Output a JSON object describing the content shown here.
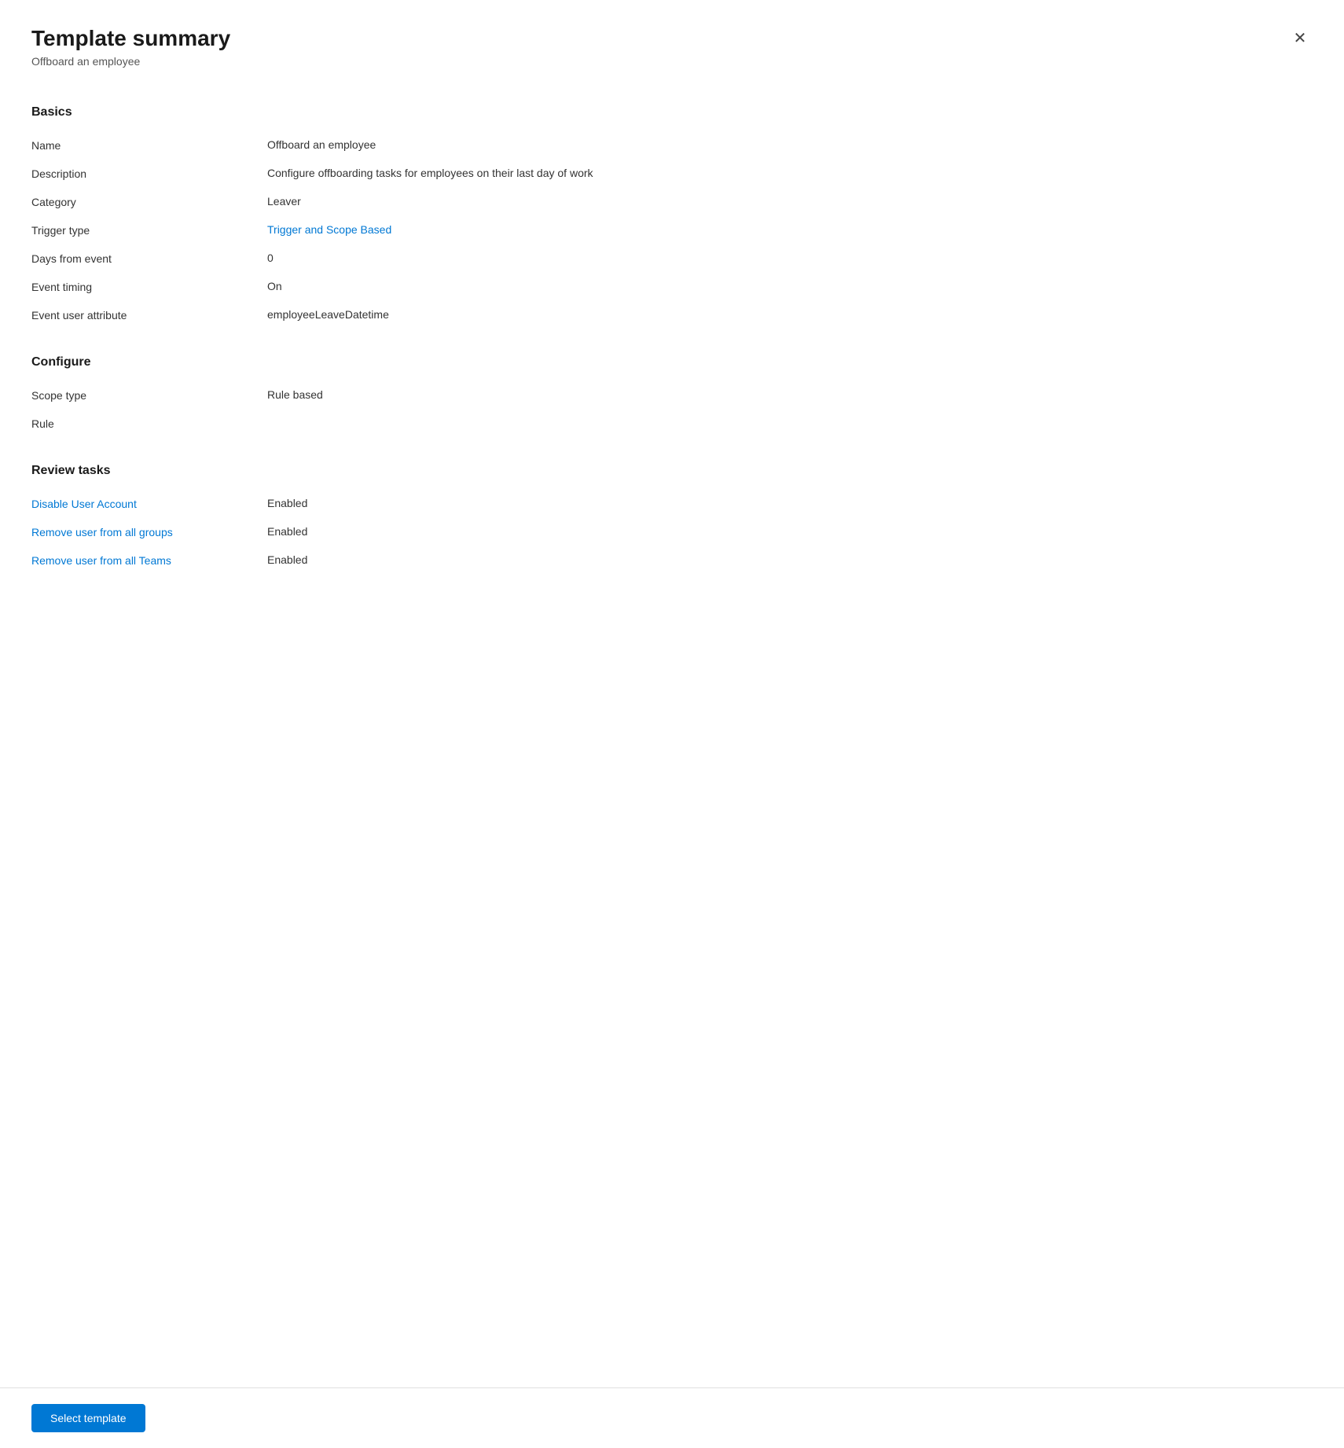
{
  "panel": {
    "title": "Template summary",
    "subtitle": "Offboard an employee",
    "close_label": "×"
  },
  "basics": {
    "section_title": "Basics",
    "fields": [
      {
        "label": "Name",
        "value": "Offboard an employee",
        "type": "text"
      },
      {
        "label": "Description",
        "value": "Configure offboarding tasks for employees on their last day of work",
        "type": "text"
      },
      {
        "label": "Category",
        "value": "Leaver",
        "type": "text"
      },
      {
        "label": "Trigger type",
        "value": "Trigger and Scope Based",
        "type": "link"
      },
      {
        "label": "Days from event",
        "value": "0",
        "type": "text"
      },
      {
        "label": "Event timing",
        "value": "On",
        "type": "text"
      },
      {
        "label": "Event user attribute",
        "value": "employeeLeaveDatetime",
        "type": "text"
      }
    ]
  },
  "configure": {
    "section_title": "Configure",
    "fields": [
      {
        "label": "Scope type",
        "value": "Rule based",
        "type": "text"
      },
      {
        "label": "Rule",
        "value": "",
        "type": "text"
      }
    ]
  },
  "review_tasks": {
    "section_title": "Review tasks",
    "fields": [
      {
        "label": "Disable User Account",
        "value": "Enabled",
        "type": "link"
      },
      {
        "label": "Remove user from all groups",
        "value": "Enabled",
        "type": "link"
      },
      {
        "label": "Remove user from all Teams",
        "value": "Enabled",
        "type": "link"
      }
    ]
  },
  "footer": {
    "select_template_label": "Select template"
  }
}
